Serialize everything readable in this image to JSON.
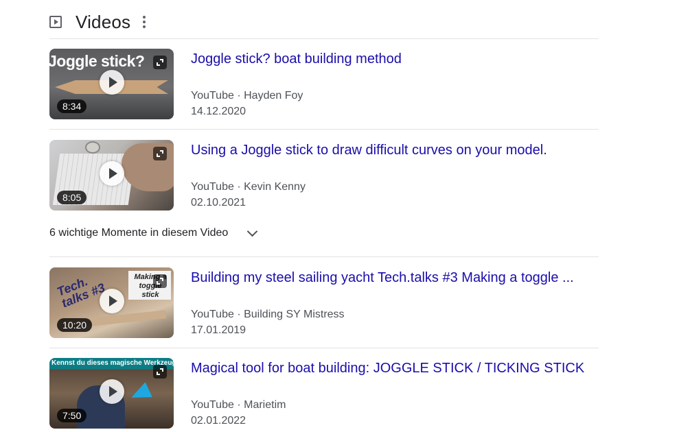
{
  "section": {
    "title": "Videos",
    "icon": "video-icon"
  },
  "videos": [
    {
      "title": "Joggle stick? boat building method",
      "source": "YouTube",
      "channel": "Hayden Foy",
      "date": "14.12.2020",
      "duration": "8:34",
      "thumb_text": "Joggle stick?"
    },
    {
      "title": "Using a Joggle stick to draw difficult curves on your model.",
      "source": "YouTube",
      "channel": "Kevin Kenny",
      "date": "02.10.2021",
      "duration": "8:05"
    },
    {
      "title": "Building my steel sailing yacht Tech.talks #3 Making a toggle ...",
      "source": "YouTube",
      "channel": "Building SY Mistress",
      "date": "17.01.2019",
      "duration": "10:20",
      "thumb_text": "Tech. talks #3",
      "thumb_text2": "Making a toggle stick"
    },
    {
      "title": "Magical tool for boat building: JOGGLE STICK / TICKING STICK",
      "source": "YouTube",
      "channel": "Marietim",
      "date": "02.01.2022",
      "duration": "7:50",
      "thumb_text": "Kennst du dieses magische Werkzeug?"
    }
  ],
  "moments": {
    "label": "6 wichtige Momente in diesem Video"
  },
  "separator": "·"
}
